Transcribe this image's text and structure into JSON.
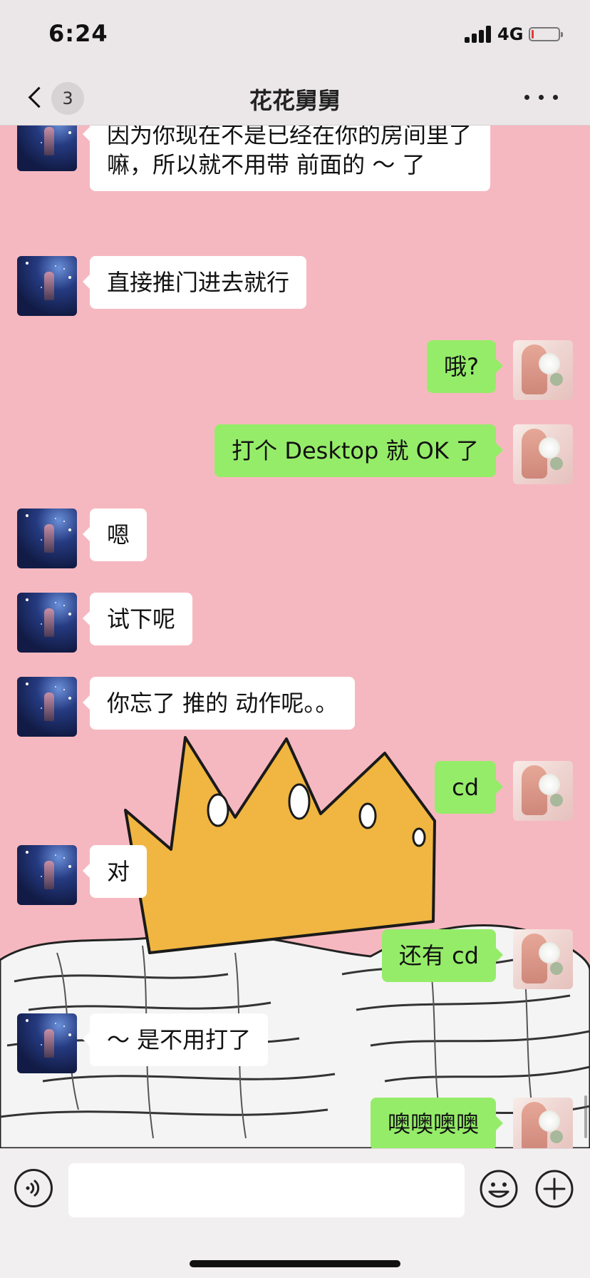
{
  "status_bar": {
    "time": "6:24",
    "network": "4G",
    "battery_level": 0.08
  },
  "nav": {
    "unread_count": "3",
    "title": "花花舅舅"
  },
  "messages": [
    {
      "side": "left",
      "text": "因为你现在不是已经在你的房间里了嘛，所以就不用带 前面的 ～ 了"
    },
    {
      "side": "left",
      "text": "直接推门进去就行"
    },
    {
      "side": "right",
      "text": "哦?"
    },
    {
      "side": "right",
      "text": "打个 Desktop 就 OK 了"
    },
    {
      "side": "left",
      "text": "嗯"
    },
    {
      "side": "left",
      "text": "试下呢"
    },
    {
      "side": "left",
      "text": "你忘了 推的 动作呢。。"
    },
    {
      "side": "right",
      "text": "cd"
    },
    {
      "side": "left",
      "text": "对"
    },
    {
      "side": "right",
      "text": "还有 cd"
    },
    {
      "side": "left",
      "text": "～ 是不用打了"
    },
    {
      "side": "right",
      "text": "噢噢噢噢"
    }
  ],
  "input_bar": {
    "placeholder": ""
  },
  "colors": {
    "chat_background": "#f6b8c0",
    "incoming_bubble": "#ffffff",
    "outgoing_bubble": "#95ec69",
    "crown": "#f0b641"
  }
}
